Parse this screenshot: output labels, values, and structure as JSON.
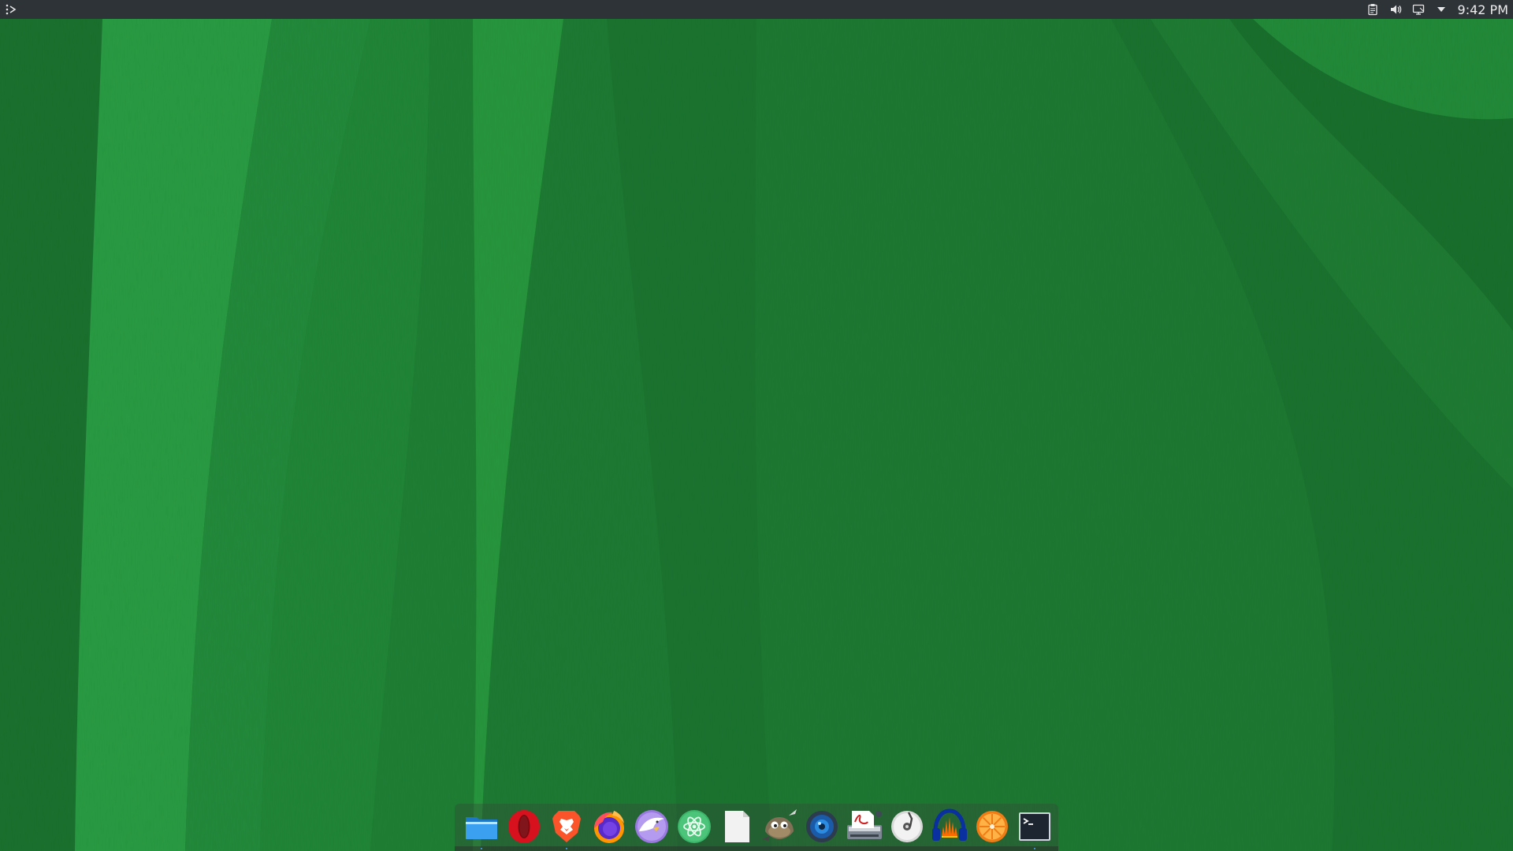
{
  "screen": {
    "type": "desktop",
    "wallpaper": {
      "base_color": "#1f7a34",
      "light_color": "#2aa34a",
      "dark_color": "#145a25"
    }
  },
  "top_panel": {
    "background": "#2e3338",
    "app_menu_icon": "app-launcher-icon",
    "tray": {
      "icons": [
        "clipboard-icon",
        "volume-icon",
        "display-icon",
        "expand-tray-icon"
      ]
    },
    "clock": "9:42 PM"
  },
  "dock": {
    "apps": [
      {
        "icon": "file-manager-icon",
        "running": true
      },
      {
        "icon": "opera-browser-icon",
        "running": false
      },
      {
        "icon": "brave-browser-icon",
        "running": true
      },
      {
        "icon": "firefox-browser-icon",
        "running": false
      },
      {
        "icon": "eagle-app-icon",
        "running": false
      },
      {
        "icon": "atom-editor-icon",
        "running": false
      },
      {
        "icon": "text-document-icon",
        "running": false
      },
      {
        "icon": "gimp-icon",
        "running": false
      },
      {
        "icon": "webcam-icon",
        "running": false
      },
      {
        "icon": "pdf-scanner-icon",
        "running": false
      },
      {
        "icon": "disc-burner-icon",
        "running": false
      },
      {
        "icon": "audacity-icon",
        "running": false
      },
      {
        "icon": "orange-app-icon",
        "running": false
      },
      {
        "icon": "terminal-icon",
        "running": true
      }
    ]
  }
}
